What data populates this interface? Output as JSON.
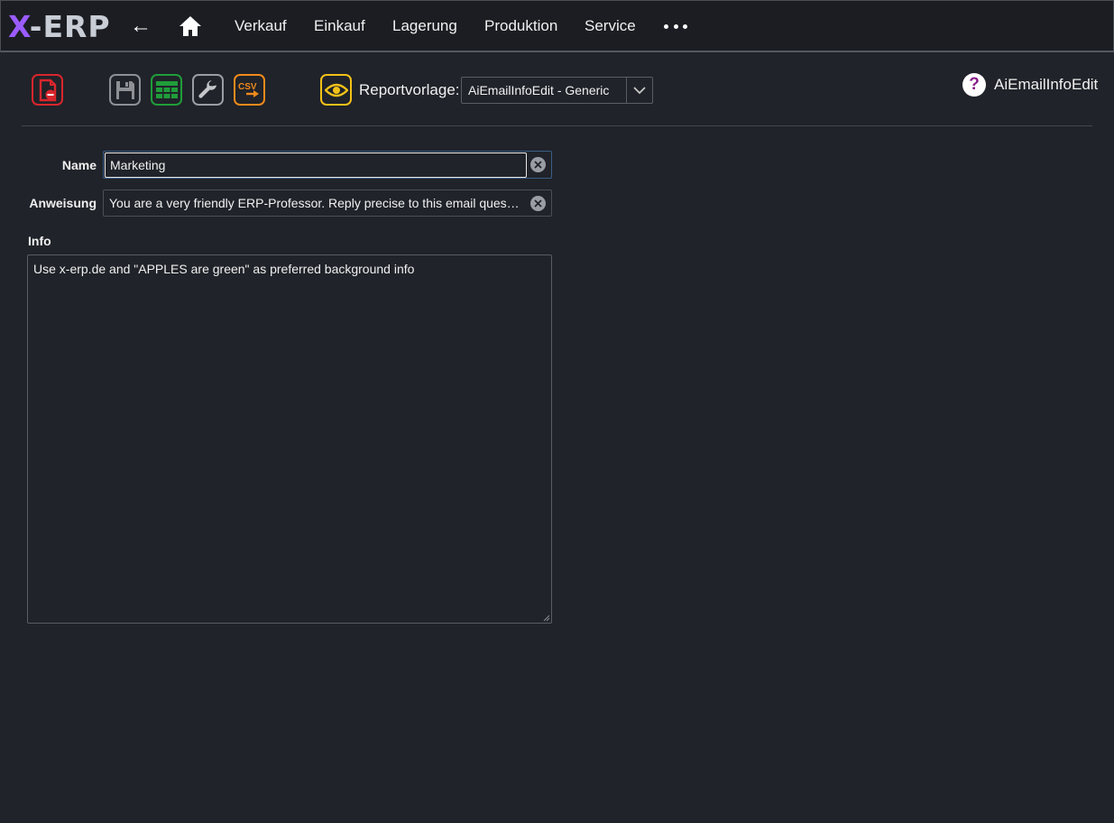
{
  "app": {
    "logo_prefix": "X",
    "logo_rest": "-ERP",
    "back_symbol": "←",
    "more_label": "•••"
  },
  "nav": {
    "items": [
      {
        "label": "Verkauf"
      },
      {
        "label": "Einkauf"
      },
      {
        "label": "Lagerung"
      },
      {
        "label": "Produktion"
      },
      {
        "label": "Service"
      }
    ]
  },
  "toolbar": {
    "buttons": [
      {
        "icon": "delete-document-icon",
        "color": "#d9262c"
      },
      {
        "icon": "save-icon",
        "color": "#8e9095"
      },
      {
        "icon": "table-icon",
        "color": "#1f9d3a"
      },
      {
        "icon": "wrench-icon",
        "color": "#9a9da3"
      },
      {
        "icon": "csv-export-icon",
        "color": "#f08a1c",
        "text": "CSV"
      },
      {
        "icon": "eye-icon",
        "color": "#f2c11a"
      }
    ],
    "report_label": "Reportvorlage:",
    "report_value": "AiEmailInfoEdit - Generic"
  },
  "header": {
    "help_symbol": "?",
    "page_id": "AiEmailInfoEdit"
  },
  "form": {
    "name_label": "Name",
    "name_value": "Marketing",
    "instruction_label": "Anweisung",
    "instruction_value": "You are a very friendly ERP-Professor. Reply precise to this email ques…",
    "info_label": "Info",
    "info_value": "Use x-erp.de and \"APPLES are green\" as preferred background info"
  },
  "colors": {
    "background": "#202329",
    "topbar": "#1b1d22",
    "accent_purple": "#9b5cff",
    "help_icon": "#8a1f8a"
  }
}
